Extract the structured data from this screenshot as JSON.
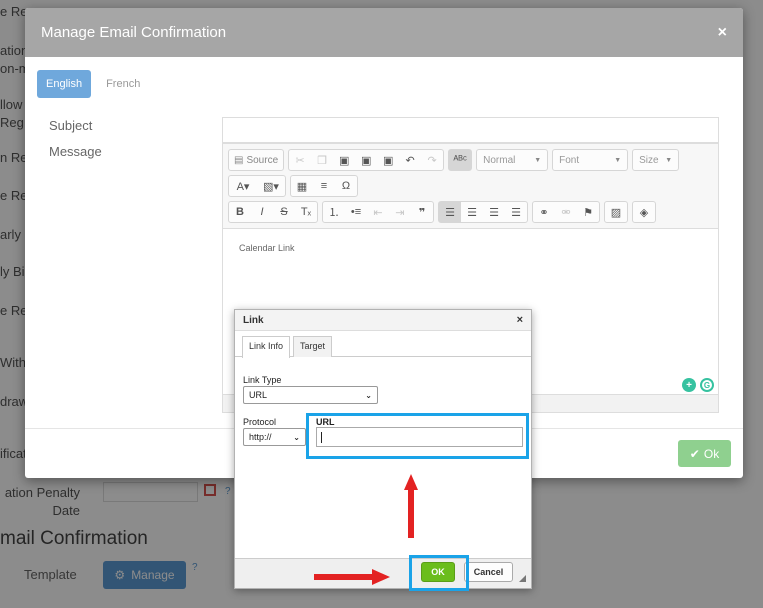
{
  "background": {
    "side_labels": [
      "e Re",
      "ation",
      "on-m",
      "llow",
      "Reg",
      "n Re",
      "e Re",
      "arly",
      "ly Bi",
      "e Re",
      "Withd",
      "draw",
      "ification"
    ],
    "penalty_label": "ation Penalty Date",
    "section_heading": "mail Confirmation",
    "template_label": "Template",
    "manage_button": "Manage"
  },
  "modal": {
    "title": "Manage Email Confirmation",
    "close": "×",
    "tabs": [
      "English",
      "French"
    ],
    "subject_label": "Subject",
    "message_label": "Message",
    "ok_button": "Ok"
  },
  "editor": {
    "source_label": "Source",
    "format_combo": "Normal",
    "font_combo": "Font",
    "size_combo": "Size",
    "content": "Calendar Link"
  },
  "link_dialog": {
    "title": "Link",
    "close": "×",
    "tabs": [
      "Link Info",
      "Target"
    ],
    "link_type_label": "Link Type",
    "link_type_value": "URL",
    "protocol_label": "Protocol",
    "protocol_value": "http://",
    "url_label": "URL",
    "url_value": "",
    "ok_button": "OK",
    "cancel_button": "Cancel"
  },
  "colors": {
    "header_bg": "#a6a6a6",
    "accent_blue": "#6fa8dc",
    "ok_green": "#6bbd1c",
    "highlight": "#1aa3e8",
    "arrow_red": "#e32222"
  }
}
